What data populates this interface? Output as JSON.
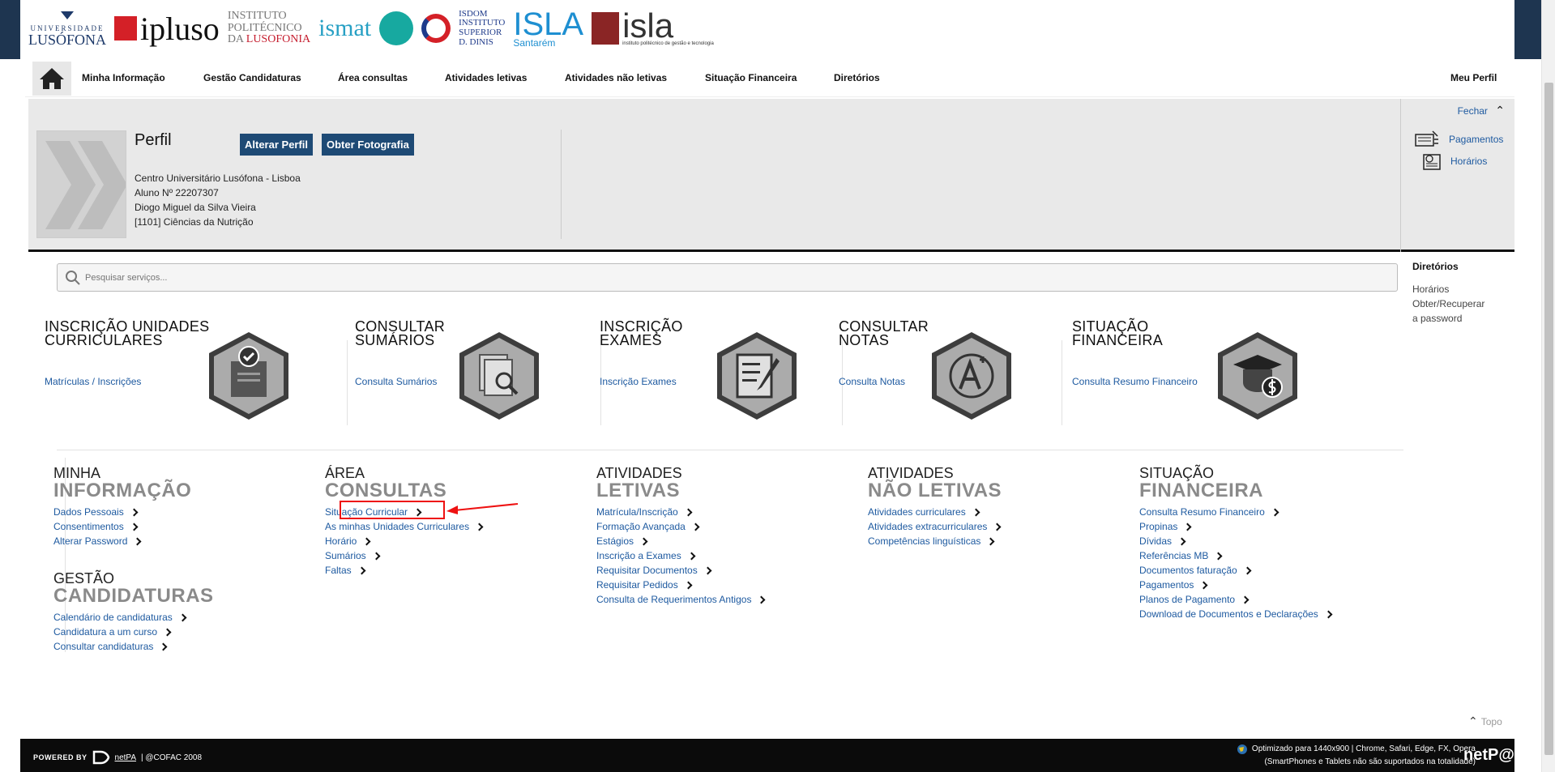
{
  "header": {
    "logos": {
      "ulht_top": "UNIVERSIDADE",
      "ulht_bottom": "LUSÓFONA",
      "ipluso": "ipluso",
      "ipl_1": "INSTITUTO",
      "ipl_2": "POLITÉCNICO",
      "ipl_3a": "DA",
      "ipl_3b": "LUSOFONIA",
      "ismat": "ismat",
      "isdom_1": "ISDOM",
      "isdom_2": "INSTITUTO",
      "isdom_3": "SUPERIOR",
      "isdom_4": "D. DINIS",
      "isla_santarem": "ISLA",
      "isla_santarem_sub": "Santarém",
      "isla": "isla",
      "isla_sub": "instituto politécnico de gestão e tecnologia"
    }
  },
  "nav": {
    "items": [
      "Minha Informação",
      "Gestão Candidaturas",
      "Área consultas",
      "Atividades letivas",
      "Atividades não letivas",
      "Situação Financeira",
      "Diretórios"
    ],
    "profile": "Meu Perfil"
  },
  "profile": {
    "close": "Fechar",
    "title": "Perfil",
    "alter_btn": "Alterar Perfil",
    "photo_btn": "Obter Fotografia",
    "institution": "Centro Universitário Lusófona - Lisboa",
    "student_no": "Aluno Nº 22207307",
    "name": "Diogo Miguel da Silva Vieira",
    "course": "[1101] Ciências da Nutrição",
    "quick_links": [
      "Pagamentos",
      "Horários"
    ]
  },
  "search": {
    "placeholder": "Pesquisar serviços..."
  },
  "sidebar_dir": {
    "title": "Diretórios",
    "links": [
      "Horários",
      "Obter/Recuperar",
      "a password"
    ]
  },
  "tiles": [
    {
      "t1": "INSCRIÇÃO UNIDADES",
      "t2": "CURRICULARES",
      "link": "Matrículas / Inscrições",
      "icon": "clipboard-check-icon"
    },
    {
      "t1": "CONSULTAR",
      "t2": "SUMÁRIOS",
      "link": "Consulta Sumários",
      "icon": "document-search-icon"
    },
    {
      "t1": "INSCRIÇÃO",
      "t2": "EXAMES",
      "link": "Inscrição Exames",
      "icon": "exam-pen-icon"
    },
    {
      "t1": "CONSULTAR",
      "t2": "NOTAS",
      "link": "Consulta Notas",
      "icon": "grade-a-plus-icon"
    },
    {
      "t1": "SITUAÇÃO",
      "t2": "FINANCEIRA",
      "link": "Consulta Resumo Financeiro",
      "icon": "graduate-dollar-icon"
    }
  ],
  "menus": {
    "minha": {
      "h1": "MINHA",
      "h2": "INFORMAÇÃO",
      "items": [
        "Dados Pessoais",
        "Consentimentos",
        "Alterar Password"
      ]
    },
    "gestao": {
      "h1": "GESTÃO",
      "h2": "CANDIDATURAS",
      "items": [
        "Calendário de candidaturas",
        "Candidatura a um curso",
        "Consultar candidaturas"
      ]
    },
    "area": {
      "h1": "ÁREA",
      "h2": "CONSULTAS",
      "items": [
        "Situação Curricular",
        "As minhas Unidades Curriculares",
        "Horário",
        "Sumários",
        "Faltas"
      ]
    },
    "letivas": {
      "h1": "ATIVIDADES",
      "h2": "LETIVAS",
      "items": [
        "Matrícula/Inscrição",
        "Formação Avançada",
        "Estágios",
        "Inscrição a Exames",
        "Requisitar Documentos",
        "Requisitar Pedidos",
        "Consulta de Requerimentos Antigos"
      ]
    },
    "naoletivas": {
      "h1": "ATIVIDADES",
      "h2": "NÃO LETIVAS",
      "items": [
        "Atividades curriculares",
        "Atividades extracurriculares",
        "Competências linguísticas"
      ]
    },
    "financeira": {
      "h1": "SITUAÇÃO",
      "h2": "FINANCEIRA",
      "items": [
        "Consulta Resumo Financeiro",
        "Propinas",
        "Dívidas",
        "Referências MB",
        "Documentos faturação",
        "Pagamentos",
        "Planos de Pagamento",
        "Download de Documentos e Declarações"
      ]
    }
  },
  "topo": "Topo",
  "footer": {
    "powered": "POWERED BY",
    "netpa": "netPA",
    "copy": "| @COFAC 2008",
    "optim": "Optimizado para 1440x900 | Chrome, Safari, Edge, FX, Opera",
    "optim2": "(SmartPhones e Tablets não são suportados na totalidade)",
    "brand": "netP@"
  },
  "colors": {
    "link": "#1e5aa0",
    "button": "#1e4a75",
    "highlight": "#e11111"
  }
}
